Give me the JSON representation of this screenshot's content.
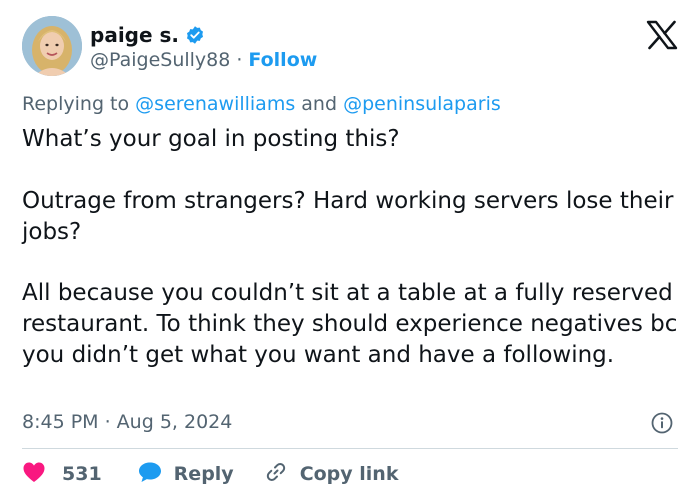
{
  "author": {
    "display_name": "paige s.",
    "handle": "@PaigeSully88",
    "separator": "·",
    "follow_label": "Follow"
  },
  "reply_context": {
    "prefix": "Replying to",
    "mention_1": "@serenawilliams",
    "conjunction": "and",
    "mention_2": "@peninsulaparis"
  },
  "tweet": {
    "paragraph_1": "What’s your goal in posting this?",
    "paragraph_2": "Outrage from strangers? Hard working servers lose their jobs?",
    "paragraph_3": "All because you couldn’t sit at a table at a fully reserved restaurant. To think they should experience negatives bc you didn’t get what you want and have a following.",
    "timestamp": "8:45 PM · Aug 5, 2024"
  },
  "actions": {
    "like_count": "531",
    "reply_label": "Reply",
    "copy_link_label": "Copy link"
  },
  "icons": {
    "verified": "verified-badge-icon",
    "x_logo": "x-logo-icon",
    "info": "info-icon",
    "heart": "heart-icon",
    "reply": "speech-bubble-icon",
    "link": "link-icon"
  },
  "colors": {
    "accent": "#1d9bf0",
    "text": "#0f1419",
    "secondary_text": "#536471",
    "heart": "#f91880",
    "divider": "#cfd9de"
  }
}
